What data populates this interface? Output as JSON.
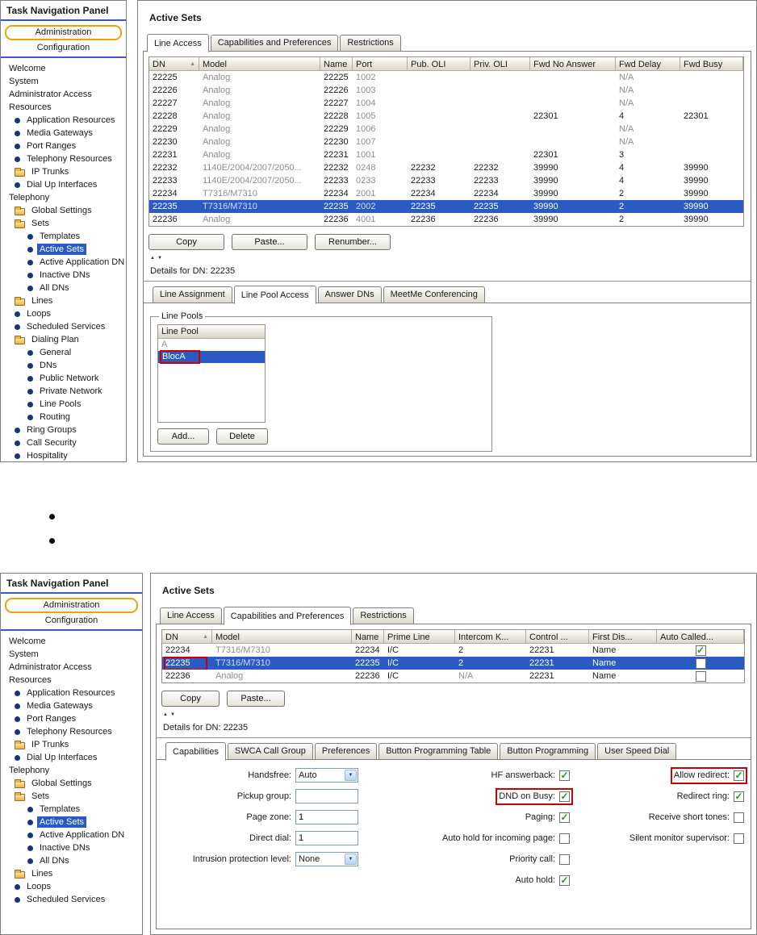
{
  "colors": {
    "selection": "#2a5ac4",
    "annotation": "#cc0000",
    "tab_orange": "#f0a10a",
    "nav_rule_blue": "#3c59c2",
    "check_green": "#1ba01b"
  },
  "bullet_list": {
    "items": [
      "",
      ""
    ]
  },
  "screen1": {
    "nav": {
      "title": "Task Navigation Panel",
      "admin_tab": "Administration",
      "config_tab": "Configuration",
      "tree": [
        {
          "label": "Welcome",
          "icon": "none",
          "indent": 0
        },
        {
          "label": "System",
          "icon": "none",
          "indent": 0
        },
        {
          "label": "Administrator Access",
          "icon": "none",
          "indent": 0
        },
        {
          "label": "Resources",
          "icon": "none",
          "indent": 0
        },
        {
          "label": "Application Resources",
          "icon": "bullet",
          "indent": 1
        },
        {
          "label": "Media Gateways",
          "icon": "bullet",
          "indent": 1
        },
        {
          "label": "Port Ranges",
          "icon": "bullet",
          "indent": 1
        },
        {
          "label": "Telephony Resources",
          "icon": "bullet",
          "indent": 1
        },
        {
          "label": "IP Trunks",
          "icon": "folder",
          "indent": 1
        },
        {
          "label": "Dial Up Interfaces",
          "icon": "bullet",
          "indent": 1
        },
        {
          "label": "Telephony",
          "icon": "none",
          "indent": 0
        },
        {
          "label": "Global Settings",
          "icon": "folder",
          "indent": 1
        },
        {
          "label": "Sets",
          "icon": "folder",
          "indent": 1
        },
        {
          "label": "Templates",
          "icon": "bullet",
          "indent": 2
        },
        {
          "label": "Active Sets",
          "icon": "bullet",
          "indent": 2,
          "selected": true
        },
        {
          "label": "Active Application DN",
          "icon": "bullet",
          "indent": 2
        },
        {
          "label": "Inactive DNs",
          "icon": "bullet",
          "indent": 2
        },
        {
          "label": "All DNs",
          "icon": "bullet",
          "indent": 2
        },
        {
          "label": "Lines",
          "icon": "folder",
          "indent": 1
        },
        {
          "label": "Loops",
          "icon": "bullet",
          "indent": 1
        },
        {
          "label": "Scheduled Services",
          "icon": "bullet",
          "indent": 1
        },
        {
          "label": "Dialing Plan",
          "icon": "folder",
          "indent": 1
        },
        {
          "label": "General",
          "icon": "bullet",
          "indent": 2
        },
        {
          "label": "DNs",
          "icon": "bullet",
          "indent": 2
        },
        {
          "label": "Public Network",
          "icon": "bullet",
          "indent": 2
        },
        {
          "label": "Private Network",
          "icon": "bullet",
          "indent": 2
        },
        {
          "label": "Line Pools",
          "icon": "bullet",
          "indent": 2
        },
        {
          "label": "Routing",
          "icon": "bullet",
          "indent": 2
        },
        {
          "label": "Ring Groups",
          "icon": "bullet",
          "indent": 1
        },
        {
          "label": "Call Security",
          "icon": "bullet",
          "indent": 1
        },
        {
          "label": "Hospitality",
          "icon": "bullet",
          "indent": 1
        }
      ]
    },
    "main": {
      "title": "Active Sets",
      "tabs": [
        {
          "label": "Line Access",
          "active": true
        },
        {
          "label": "Capabilities and Preferences",
          "active": false
        },
        {
          "label": "Restrictions",
          "active": false
        }
      ],
      "table": {
        "sort_col": 0,
        "columns": [
          "DN",
          "Model",
          "Name",
          "Port",
          "Pub. OLI",
          "Priv. OLI",
          "Fwd No Answer",
          "Fwd Delay",
          "Fwd Busy"
        ],
        "rows": [
          {
            "cells": [
              "22225",
              "Analog",
              "22225",
              "1002",
              "",
              "",
              "",
              "N/A",
              ""
            ]
          },
          {
            "cells": [
              "22226",
              "Analog",
              "22226",
              "1003",
              "",
              "",
              "",
              "N/A",
              ""
            ]
          },
          {
            "cells": [
              "22227",
              "Analog",
              "22227",
              "1004",
              "",
              "",
              "",
              "N/A",
              ""
            ]
          },
          {
            "cells": [
              "22228",
              "Analog",
              "22228",
              "1005",
              "",
              "",
              "22301",
              "4",
              "22301"
            ]
          },
          {
            "cells": [
              "22229",
              "Analog",
              "22229",
              "1006",
              "",
              "",
              "",
              "N/A",
              ""
            ]
          },
          {
            "cells": [
              "22230",
              "Analog",
              "22230",
              "1007",
              "",
              "",
              "",
              "N/A",
              ""
            ]
          },
          {
            "cells": [
              "22231",
              "Analog",
              "22231",
              "1001",
              "",
              "",
              "22301",
              "3",
              ""
            ]
          },
          {
            "cells": [
              "22232",
              "1140E/2004/2007/2050...",
              "22232",
              "0248",
              "22232",
              "22232",
              "39990",
              "4",
              "39990"
            ]
          },
          {
            "cells": [
              "22233",
              "1140E/2004/2007/2050...",
              "22233",
              "0233",
              "22233",
              "22233",
              "39990",
              "4",
              "39990"
            ]
          },
          {
            "cells": [
              "22234",
              "T7316/M7310",
              "22234",
              "2001",
              "22234",
              "22234",
              "39990",
              "2",
              "39990"
            ]
          },
          {
            "cells": [
              "22235",
              "T7316/M7310",
              "22235",
              "2002",
              "22235",
              "22235",
              "39990",
              "2",
              "39990"
            ],
            "selected": true
          },
          {
            "cells": [
              "22236",
              "Analog",
              "22236",
              "4001",
              "22236",
              "22236",
              "39990",
              "2",
              "39990"
            ]
          }
        ]
      },
      "buttons": [
        "Copy",
        "Paste...",
        "Renumber..."
      ],
      "details_title": "Details for DN: 22235",
      "detail_tabs": [
        {
          "label": "Line Assignment",
          "active": false
        },
        {
          "label": "Line Pool Access",
          "active": true
        },
        {
          "label": "Answer DNs",
          "active": false
        },
        {
          "label": "MeetMe Conferencing",
          "active": false
        }
      ],
      "line_pools": {
        "group_title": "Line Pools",
        "column_header": "Line Pool",
        "rows": [
          {
            "label": "A",
            "gray": true
          },
          {
            "label": "BlocA",
            "selected": true,
            "annotated": true
          }
        ],
        "buttons": [
          "Add...",
          "Delete"
        ]
      }
    }
  },
  "screen2": {
    "nav": {
      "title": "Task Navigation Panel",
      "admin_tab": "Administration",
      "config_tab": "Configuration",
      "tree": [
        {
          "label": "Welcome",
          "icon": "none",
          "indent": 0
        },
        {
          "label": "System",
          "icon": "none",
          "indent": 0
        },
        {
          "label": "Administrator Access",
          "icon": "none",
          "indent": 0
        },
        {
          "label": "Resources",
          "icon": "none",
          "indent": 0
        },
        {
          "label": "Application Resources",
          "icon": "bullet",
          "indent": 1
        },
        {
          "label": "Media Gateways",
          "icon": "bullet",
          "indent": 1
        },
        {
          "label": "Port Ranges",
          "icon": "bullet",
          "indent": 1
        },
        {
          "label": "Telephony Resources",
          "icon": "bullet",
          "indent": 1
        },
        {
          "label": "IP Trunks",
          "icon": "folder",
          "indent": 1
        },
        {
          "label": "Dial Up Interfaces",
          "icon": "bullet",
          "indent": 1
        },
        {
          "label": "Telephony",
          "icon": "none",
          "indent": 0
        },
        {
          "label": "Global Settings",
          "icon": "folder",
          "indent": 1
        },
        {
          "label": "Sets",
          "icon": "folder",
          "indent": 1
        },
        {
          "label": "Templates",
          "icon": "bullet",
          "indent": 2
        },
        {
          "label": "Active Sets",
          "icon": "bullet",
          "indent": 2,
          "selected": true
        },
        {
          "label": "Active Application DN",
          "icon": "bullet",
          "indent": 2
        },
        {
          "label": "Inactive DNs",
          "icon": "bullet",
          "indent": 2
        },
        {
          "label": "All DNs",
          "icon": "bullet",
          "indent": 2
        },
        {
          "label": "Lines",
          "icon": "folder",
          "indent": 1
        },
        {
          "label": "Loops",
          "icon": "bullet",
          "indent": 1
        },
        {
          "label": "Scheduled Services",
          "icon": "bullet",
          "indent": 1
        }
      ]
    },
    "main": {
      "title": "Active Sets",
      "tabs": [
        {
          "label": "Line Access",
          "active": false
        },
        {
          "label": "Capabilities and Preferences",
          "active": true
        },
        {
          "label": "Restrictions",
          "active": false
        }
      ],
      "table": {
        "sort_col": 0,
        "columns": [
          "DN",
          "Model",
          "Name",
          "Prime Line",
          "Intercom K...",
          "Control ...",
          "First Dis...",
          "Auto Called..."
        ],
        "rows": [
          {
            "cells": [
              "22234",
              "T7316/M7310",
              "22234",
              "I/C",
              "2",
              "22231",
              "Name"
            ],
            "check": true
          },
          {
            "cells": [
              "22235",
              "T7316/M7310",
              "22235",
              "I/C",
              "2",
              "22231",
              "Name"
            ],
            "check": false,
            "selected": true,
            "dn_annotated": true
          },
          {
            "cells": [
              "22236",
              "Analog",
              "22236",
              "I/C",
              "N/A",
              "22231",
              "Name"
            ],
            "check": false
          }
        ]
      },
      "buttons": [
        "Copy",
        "Paste..."
      ],
      "details_title": "Details for DN: 22235",
      "detail_tabs": [
        {
          "label": "Capabilities",
          "active": true
        },
        {
          "label": "SWCA Call Group",
          "active": false
        },
        {
          "label": "Preferences",
          "active": false
        },
        {
          "label": "Button Programming Table",
          "active": false
        },
        {
          "label": "Button Programming",
          "active": false
        },
        {
          "label": "User Speed Dial",
          "active": false
        }
      ],
      "form": {
        "fields": [
          {
            "label": "Handsfree:",
            "control": "select",
            "value": "Auto"
          },
          {
            "label": "Pickup group:",
            "control": "text",
            "value": ""
          },
          {
            "label": "Page zone:",
            "control": "text",
            "value": "1"
          },
          {
            "label": "Direct dial:",
            "control": "text",
            "value": "1"
          },
          {
            "label": "Intrusion protection level:",
            "control": "select",
            "value": "None"
          }
        ],
        "checks_middle": [
          {
            "label": "HF answerback:",
            "checked": true
          },
          {
            "label": "DND on Busy:",
            "checked": true,
            "annotated": true
          },
          {
            "label": "Paging:",
            "checked": true
          },
          {
            "label": "Auto hold for incoming page:",
            "checked": false
          },
          {
            "label": "Priority call:",
            "checked": false
          },
          {
            "label": "Auto hold:",
            "checked": true
          }
        ],
        "checks_right": [
          {
            "label": "Allow redirect:",
            "checked": true,
            "annotated": true
          },
          {
            "label": "Redirect ring:",
            "checked": true
          },
          {
            "label": "Receive short tones:",
            "checked": false
          },
          {
            "label": "Silent monitor supervisor:",
            "checked": false
          }
        ]
      }
    }
  }
}
